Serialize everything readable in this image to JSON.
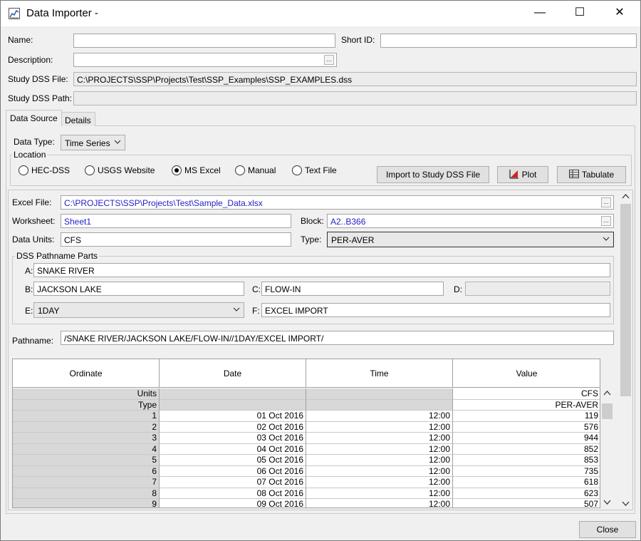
{
  "window": {
    "title": "Data Importer -",
    "minimize": "—",
    "maximize": "☐",
    "close": "✕"
  },
  "form": {
    "name_label": "Name:",
    "name_value": "",
    "shortid_label": "Short ID:",
    "shortid_value": "",
    "description_label": "Description:",
    "description_value": "",
    "ellipsis": "...",
    "studydss_file_label": "Study DSS File:",
    "studydss_file_value": "C:\\PROJECTS\\SSP\\Projects\\Test\\SSP_Examples\\SSP_EXAMPLES.dss",
    "studydss_path_label": "Study DSS Path:",
    "studydss_path_value": ""
  },
  "tabs": [
    {
      "label": "Data Source",
      "active": true
    },
    {
      "label": "Details",
      "active": false
    }
  ],
  "source": {
    "data_type_label": "Data Type:",
    "data_type_value": "Time Series",
    "location_label": "Location",
    "radios": [
      {
        "label": "HEC-DSS",
        "selected": false
      },
      {
        "label": "USGS Website",
        "selected": false
      },
      {
        "label": "MS Excel",
        "selected": true
      },
      {
        "label": "Manual",
        "selected": false
      },
      {
        "label": "Text File",
        "selected": false
      }
    ],
    "import_button": "Import to Study DSS File",
    "plot_button": "Plot",
    "tabulate_button": "Tabulate"
  },
  "excel": {
    "file_label": "Excel File:",
    "file_value": "C:\\PROJECTS\\SSP\\Projects\\Test\\Sample_Data.xlsx",
    "worksheet_label": "Worksheet:",
    "worksheet_value": "Sheet1",
    "block_label": "Block:",
    "block_value": "A2..B366",
    "units_label": "Data Units:",
    "units_value": "CFS",
    "type_label": "Type:",
    "type_value": "PER-AVER"
  },
  "parts": {
    "group_label": "DSS Pathname Parts",
    "a_label": "A:",
    "a_value": "SNAKE RIVER",
    "b_label": "B:",
    "b_value": "JACKSON LAKE",
    "c_label": "C:",
    "c_value": "FLOW-IN",
    "d_label": "D:",
    "d_value": "",
    "e_label": "E:",
    "e_value": "1DAY",
    "f_label": "F:",
    "f_value": "EXCEL IMPORT",
    "pathname_label": "Pathname:",
    "pathname_value": "/SNAKE RIVER/JACKSON LAKE/FLOW-IN//1DAY/EXCEL IMPORT/"
  },
  "table": {
    "headers": [
      "Ordinate",
      "Date",
      "Time",
      "Value"
    ],
    "units_row": {
      "label": "Units",
      "value": "CFS"
    },
    "type_row": {
      "label": "Type",
      "value": "PER-AVER"
    },
    "rows": [
      {
        "ordinate": "1",
        "date": "01 Oct 2016",
        "time": "12:00",
        "value": "119"
      },
      {
        "ordinate": "2",
        "date": "02 Oct 2016",
        "time": "12:00",
        "value": "576"
      },
      {
        "ordinate": "3",
        "date": "03 Oct 2016",
        "time": "12:00",
        "value": "944"
      },
      {
        "ordinate": "4",
        "date": "04 Oct 2016",
        "time": "12:00",
        "value": "852"
      },
      {
        "ordinate": "5",
        "date": "05 Oct 2016",
        "time": "12:00",
        "value": "853"
      },
      {
        "ordinate": "6",
        "date": "06 Oct 2016",
        "time": "12:00",
        "value": "735"
      },
      {
        "ordinate": "7",
        "date": "07 Oct 2016",
        "time": "12:00",
        "value": "618"
      },
      {
        "ordinate": "8",
        "date": "08 Oct 2016",
        "time": "12:00",
        "value": "623"
      },
      {
        "ordinate": "9",
        "date": "09 Oct 2016",
        "time": "12:00",
        "value": "507"
      }
    ]
  },
  "footer": {
    "close_button": "Close"
  }
}
